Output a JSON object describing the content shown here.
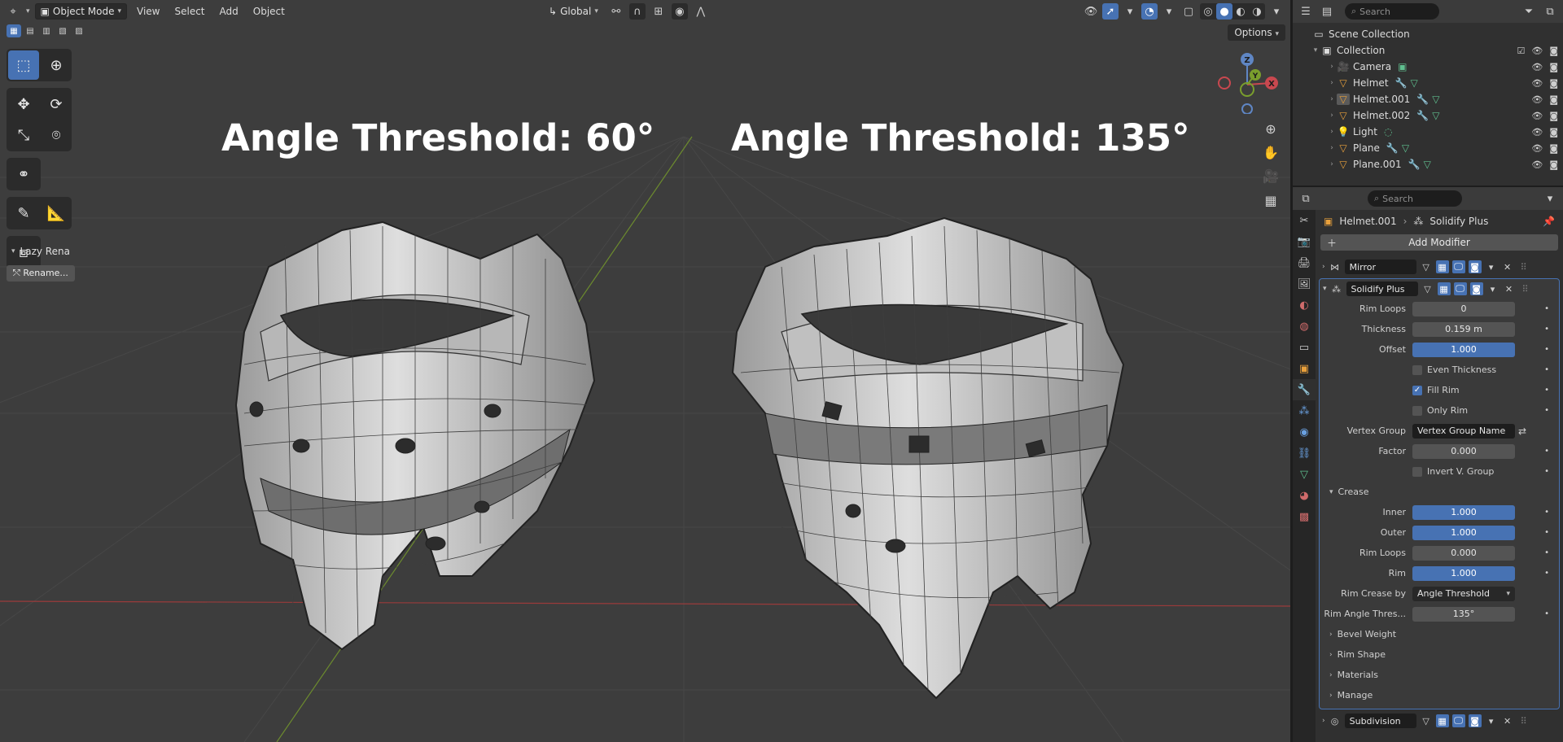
{
  "header": {
    "editor_icon": "viewport-icon",
    "mode": "Object Mode",
    "menus": [
      "View",
      "Select",
      "Add",
      "Object"
    ],
    "transform_orientation": "Global"
  },
  "viewport": {
    "options_label": "Options",
    "left_title": "Angle Threshold: 60°",
    "right_title": "Angle Threshold: 135°",
    "gizmo": {
      "z": "Z",
      "y": "Y",
      "x": "X"
    },
    "lazy_panel_title": "Lazy Rena",
    "rename_button": "Rename..."
  },
  "outliner": {
    "search_placeholder": "Search",
    "scene_collection": "Scene Collection",
    "collection": "Collection",
    "items": [
      {
        "name": "Camera",
        "type": "camera"
      },
      {
        "name": "Helmet",
        "type": "mesh"
      },
      {
        "name": "Helmet.001",
        "type": "mesh"
      },
      {
        "name": "Helmet.002",
        "type": "mesh"
      },
      {
        "name": "Light",
        "type": "light"
      },
      {
        "name": "Plane",
        "type": "mesh"
      },
      {
        "name": "Plane.001",
        "type": "mesh"
      }
    ]
  },
  "properties": {
    "search_placeholder": "Search",
    "breadcrumb_object": "Helmet.001",
    "breadcrumb_modifier": "Solidify Plus",
    "add_modifier": "Add Modifier",
    "mirror_modifier": "Mirror",
    "solidify_modifier": "Solidify Plus",
    "subdivision_modifier": "Subdivision",
    "fields": {
      "rim_loops_label": "Rim Loops",
      "rim_loops": "0",
      "thickness_label": "Thickness",
      "thickness": "0.159 m",
      "offset_label": "Offset",
      "offset": "1.000",
      "even_thickness": "Even Thickness",
      "fill_rim": "Fill Rim",
      "only_rim": "Only Rim",
      "vertex_group_label": "Vertex Group",
      "vertex_group": "Vertex Group Name",
      "factor_label": "Factor",
      "factor": "0.000",
      "invert_v_group": "Invert V. Group"
    },
    "crease": {
      "title": "Crease",
      "inner_label": "Inner",
      "inner": "1.000",
      "outer_label": "Outer",
      "outer": "1.000",
      "rim_loops_label": "Rim Loops",
      "rim_loops": "0.000",
      "rim_label": "Rim",
      "rim": "1.000",
      "rim_crease_by_label": "Rim Crease by",
      "rim_crease_by": "Angle Threshold",
      "rim_angle_label": "Rim Angle Thres...",
      "rim_angle": "135°"
    },
    "subpanels": [
      "Bevel Weight",
      "Rim Shape",
      "Materials",
      "Manage"
    ]
  }
}
